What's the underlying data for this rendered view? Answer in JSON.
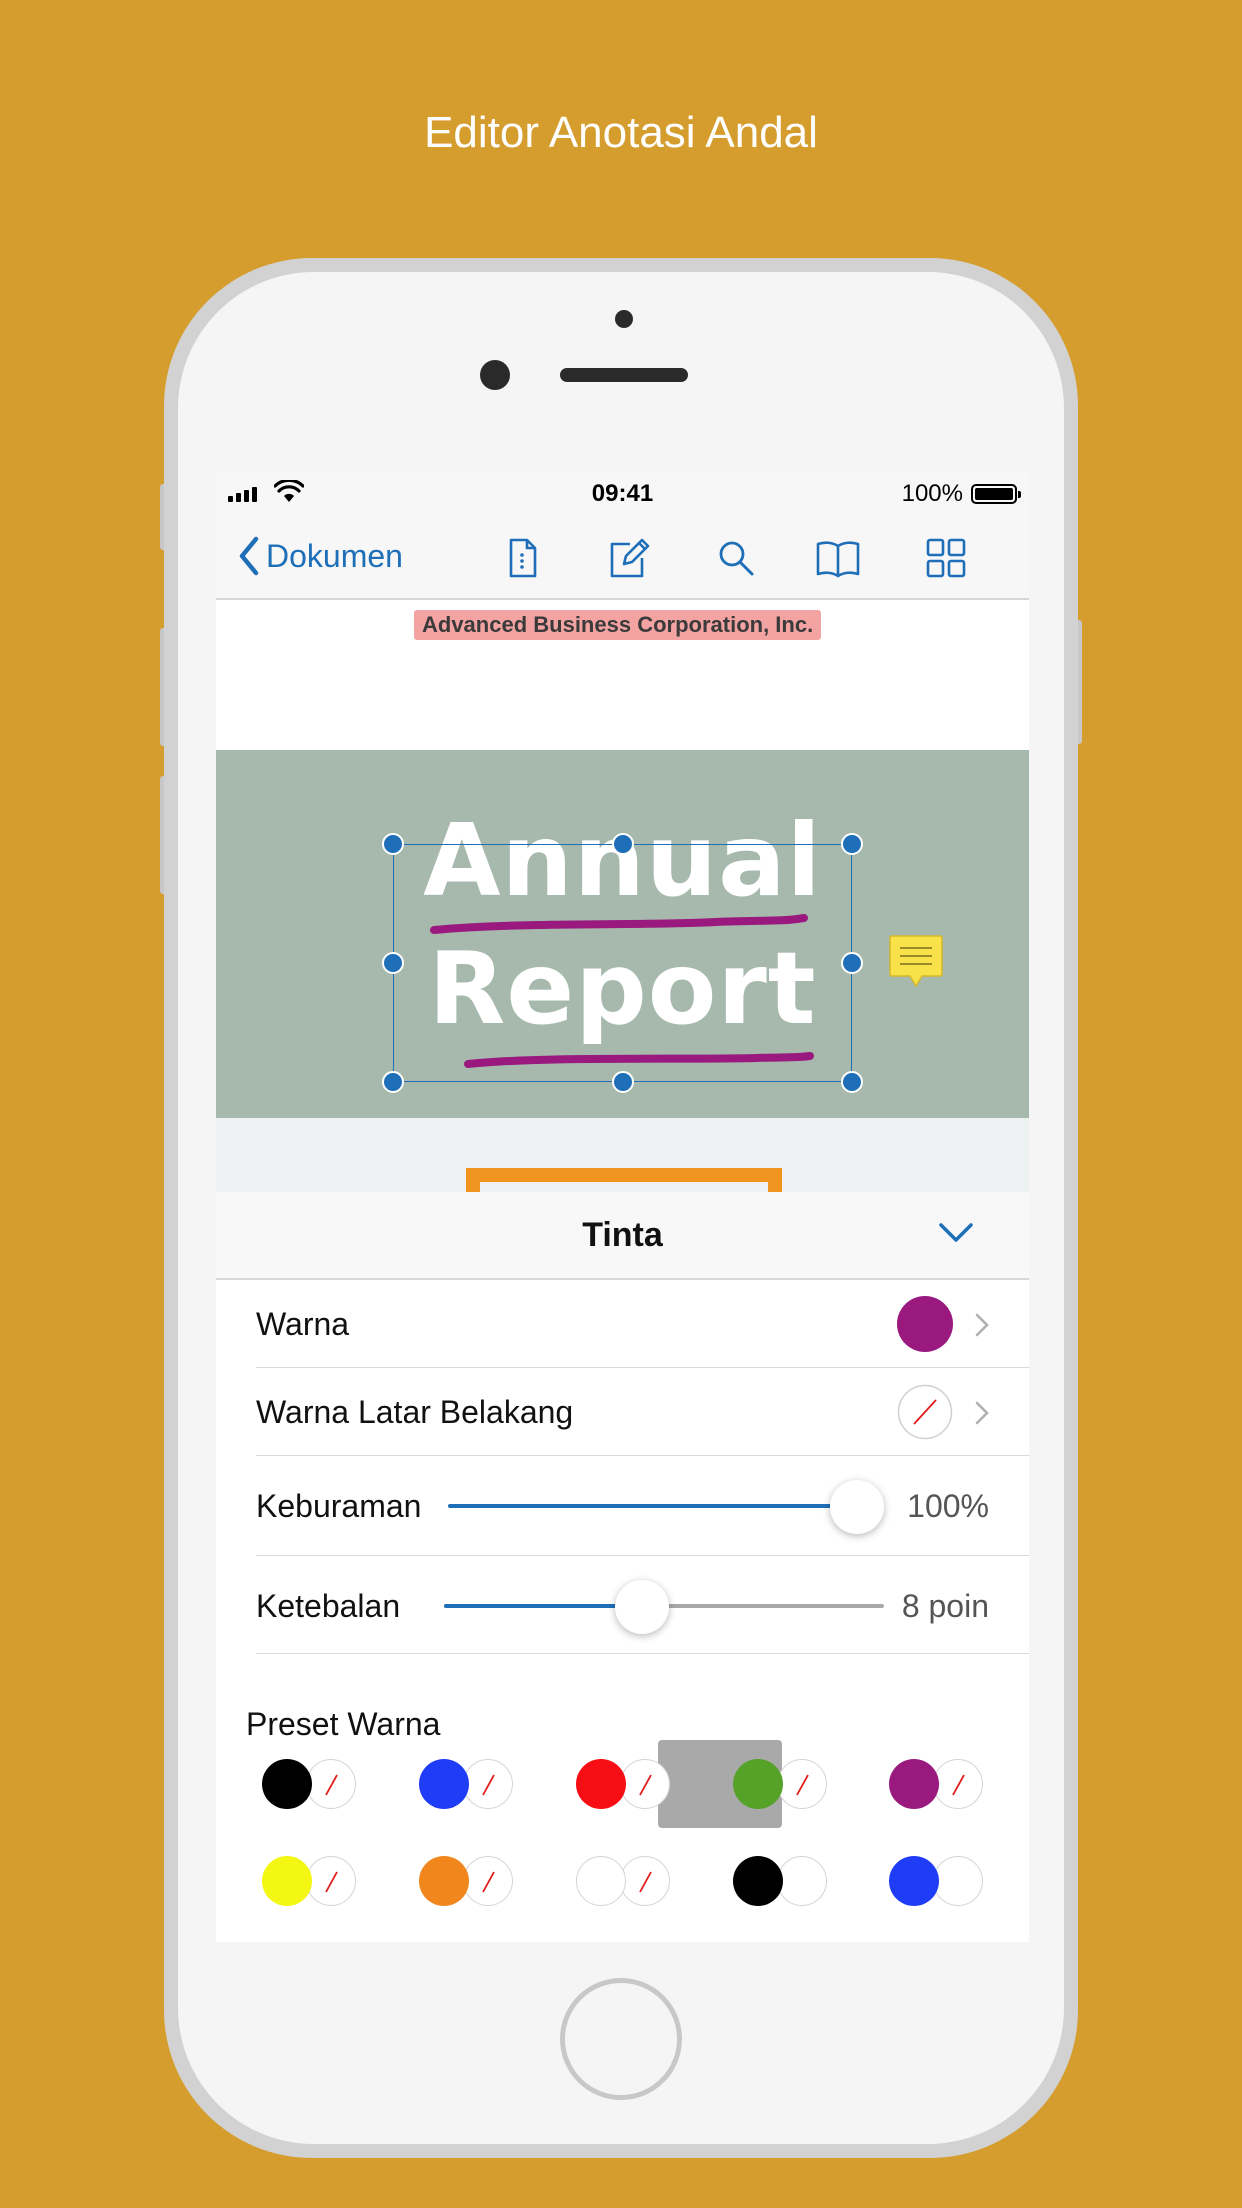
{
  "headline": "Editor Anotasi Andal",
  "statusbar": {
    "time": "09:41",
    "battery": "100%"
  },
  "navbar": {
    "back_label": "Dokumen",
    "icons": [
      "document-info-icon",
      "edit-icon",
      "search-icon",
      "bookmarks-icon",
      "grid-icon"
    ]
  },
  "document": {
    "company": "Advanced Business Corporation, Inc.",
    "title_line1": "Annual",
    "title_line2": "Report"
  },
  "panel": {
    "title": "Tinta",
    "rows": {
      "color": {
        "label": "Warna",
        "value_color": "#99197F"
      },
      "background": {
        "label": "Warna Latar Belakang",
        "value": "none"
      },
      "opacity": {
        "label": "Keburaman",
        "value": "100%",
        "level": 1.0
      },
      "thickness": {
        "label": "Ketebalan",
        "value": "8 poin",
        "level": 0.45
      }
    },
    "presets_label": "Preset Warna",
    "presets": [
      {
        "color": "#000000",
        "fill": "none"
      },
      {
        "color": "#1F3CF7",
        "fill": "none"
      },
      {
        "color": "#F70D14",
        "fill": "none"
      },
      {
        "color": "#56A128",
        "fill": "none"
      },
      {
        "color": "#99197F",
        "fill": "none",
        "selected": true
      },
      {
        "color": "#F4F714",
        "fill": "none"
      },
      {
        "color": "#F0861C",
        "fill": "none"
      },
      {
        "color": "#FFFFFF",
        "fill": "none"
      },
      {
        "color": "#000000",
        "fill": "#FFFFFF"
      },
      {
        "color": "#1F3CF7",
        "fill": "#FFFFFF"
      }
    ]
  },
  "colors": {
    "background": "#D59D2E",
    "accent": "#1E6FB8",
    "ink": "#99197F",
    "note": "#F7E24A"
  }
}
